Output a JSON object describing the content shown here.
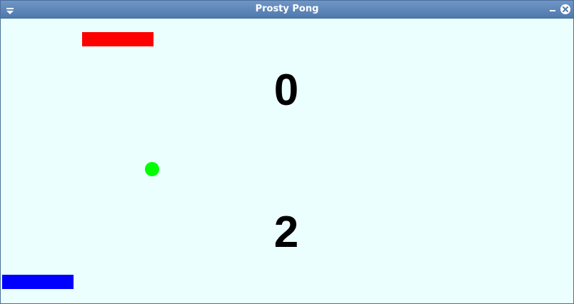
{
  "window": {
    "title": "Prosty Pong"
  },
  "icons": {
    "menu": "window-menu-icon",
    "minimize": "minimize-icon",
    "close": "close-icon"
  },
  "game": {
    "top_score": "0",
    "bottom_score": "2"
  },
  "colors": {
    "background": "#eafffe",
    "top_paddle": "#ff0000",
    "bottom_paddle": "#0000ff",
    "ball": "#00ff00",
    "score_text": "#000000"
  }
}
